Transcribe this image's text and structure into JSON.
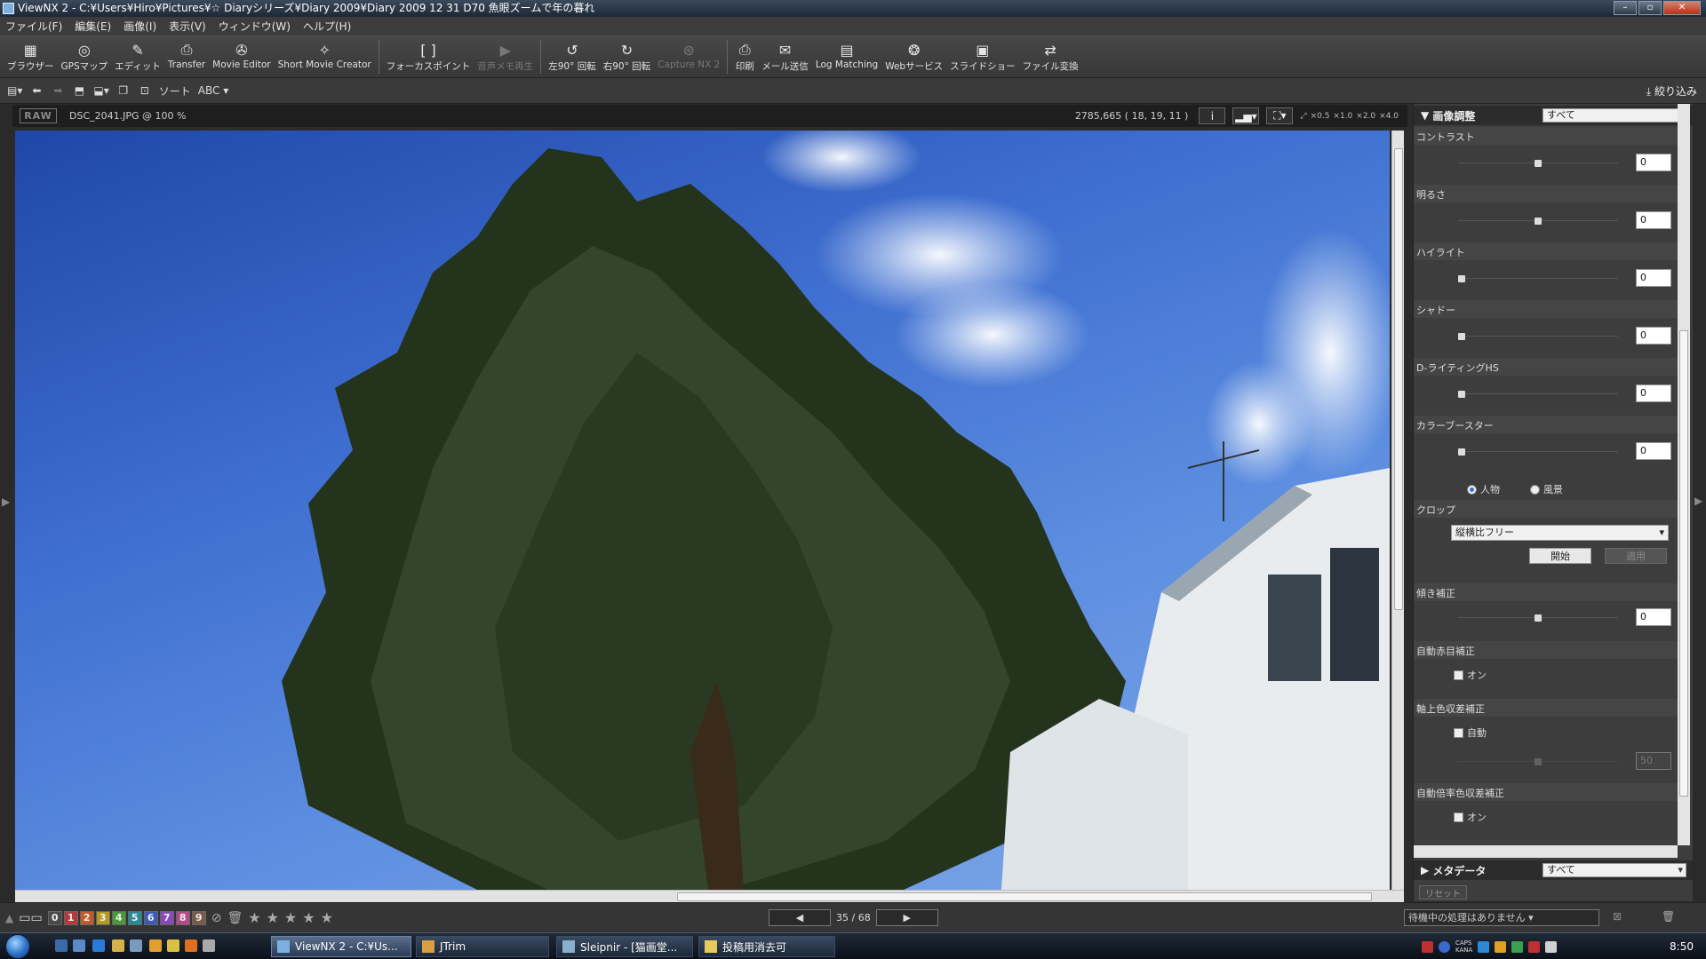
{
  "window": {
    "title": "ViewNX 2 - C:¥Users¥Hiro¥Pictures¥☆ Diaryシリーズ¥Diary 2009¥Diary 2009 12 31 D70 魚眼ズームで年の暮れ",
    "min": "–",
    "max": "▫",
    "close": "✕"
  },
  "menu": [
    "ファイル(F)",
    "編集(E)",
    "画像(I)",
    "表示(V)",
    "ウィンドウ(W)",
    "ヘルプ(H)"
  ],
  "toolbar": [
    {
      "icon": "browser-icon",
      "glyph": "▦",
      "label": "ブラウザー",
      "enabled": true
    },
    {
      "icon": "gps-map-icon",
      "glyph": "◎",
      "label": "GPSマップ",
      "enabled": true
    },
    {
      "icon": "edit-icon",
      "glyph": "✎",
      "label": "エディット",
      "enabled": true
    },
    {
      "icon": "transfer-icon",
      "glyph": "⎙",
      "label": "Transfer",
      "enabled": true
    },
    {
      "icon": "movie-editor-icon",
      "glyph": "✇",
      "label": "Movie Editor",
      "enabled": true
    },
    {
      "icon": "short-movie-creator-icon",
      "glyph": "✧",
      "label": "Short Movie Creator",
      "enabled": true
    },
    {
      "icon": "focus-point-icon",
      "glyph": "[ ]",
      "label": "フォーカスポイント",
      "enabled": true
    },
    {
      "icon": "voice-memo-icon",
      "glyph": "▶",
      "label": "音声メモ再生",
      "enabled": false
    },
    {
      "icon": "rotate-left-icon",
      "glyph": "↺",
      "label": "左90° 回転",
      "enabled": true
    },
    {
      "icon": "rotate-right-icon",
      "glyph": "↻",
      "label": "右90° 回転",
      "enabled": true
    },
    {
      "icon": "capture-nx2-icon",
      "glyph": "⊛",
      "label": "Capture NX 2",
      "enabled": false
    },
    {
      "icon": "print-icon",
      "glyph": "⎙",
      "label": "印刷",
      "enabled": true
    },
    {
      "icon": "mail-icon",
      "glyph": "✉",
      "label": "メール送信",
      "enabled": true
    },
    {
      "icon": "log-matching-icon",
      "glyph": "▤",
      "label": "Log Matching",
      "enabled": true
    },
    {
      "icon": "web-service-icon",
      "glyph": "❂",
      "label": "Webサービス",
      "enabled": true
    },
    {
      "icon": "slideshow-icon",
      "glyph": "▣",
      "label": "スライドショー",
      "enabled": true
    },
    {
      "icon": "file-convert-icon",
      "glyph": "⇄",
      "label": "ファイル変換",
      "enabled": true
    }
  ],
  "subbar": {
    "sort_label": "ソート",
    "sort_value": "ABC",
    "narrow_label": "絞り込み"
  },
  "viewer": {
    "raw_badge": "RAW",
    "filename": "DSC_2041.JPG @ 100 %",
    "coords": "2785,665 ( 18, 19, 11 )",
    "info_button": "i",
    "zoom_levels": [
      "×0.5",
      "×1.0",
      "×2.0",
      "×4.0"
    ]
  },
  "bottom": {
    "labels": [
      "0",
      "1",
      "2",
      "3",
      "4",
      "5",
      "6",
      "7",
      "8",
      "9"
    ],
    "label_colors": [
      "#4a4a4a",
      "#b23a3a",
      "#c25a2a",
      "#b59a22",
      "#4a9a3a",
      "#2a8a9a",
      "#3a5ab5",
      "#8a4ab5",
      "#b54a8a",
      "#7a5a4a"
    ],
    "stars": [
      "★",
      "★",
      "★",
      "★",
      "★"
    ],
    "prev": "◀",
    "next": "▶",
    "page": "35 / 68",
    "processing": "待機中の処理はありません"
  },
  "panel": {
    "header": "画像調整",
    "header_filter": "すべて",
    "sections": [
      {
        "title": "コントラスト",
        "value": "0",
        "knob": 0.5
      },
      {
        "title": "明るさ",
        "value": "0",
        "knob": 0.5
      },
      {
        "title": "ハイライト",
        "value": "0",
        "knob": 0.0
      },
      {
        "title": "シャドー",
        "value": "0",
        "knob": 0.0
      },
      {
        "title": "D-ライティングHS",
        "value": "0",
        "knob": 0.0
      },
      {
        "title": "カラーブースター",
        "value": "0",
        "knob": 0.0
      }
    ],
    "radio_person": "人物",
    "radio_landscape": "風景",
    "crop_title": "クロップ",
    "crop_select": "縦横比フリー",
    "crop_start": "開始",
    "crop_apply": "適用",
    "tilt_title": "傾き補正",
    "tilt_value": "0",
    "redeye_title": "自動赤目補正",
    "redeye_cb": "オン",
    "axial_title": "軸上色収差補正",
    "axial_cb": "自動",
    "axial_value": "50",
    "lateral_title": "自動倍率色収差補正",
    "lateral_cb": "オン",
    "meta_header": "メタデータ",
    "meta_filter": "すべて",
    "reset": "リセット"
  },
  "taskbar": {
    "tasks": [
      "ViewNX 2 - C:¥Us...",
      "JTrim",
      "Sleipnir - [猫画堂...",
      "投稿用消去可"
    ],
    "clock": "8:50"
  }
}
